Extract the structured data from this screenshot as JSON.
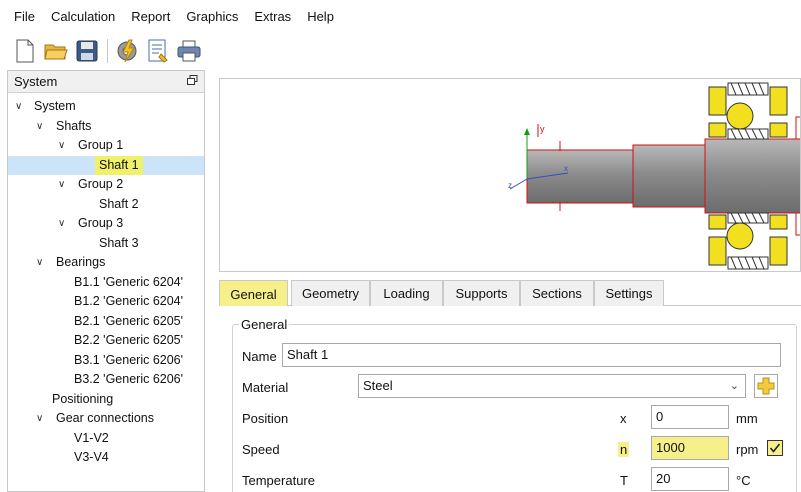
{
  "menu": [
    "File",
    "Calculation",
    "Report",
    "Graphics",
    "Extras",
    "Help"
  ],
  "toolbar": {
    "icons": [
      "new-file-icon",
      "open-folder-icon",
      "save-icon",
      "calculate-icon",
      "report-icon",
      "print-icon"
    ]
  },
  "left_panel": {
    "title": "System",
    "float_icon": "restore-window-icon",
    "tree": [
      {
        "label": "System",
        "level": 0,
        "expanded": true
      },
      {
        "label": "Shafts",
        "level": 1,
        "expanded": true
      },
      {
        "label": "Group 1",
        "level": 2,
        "expanded": true
      },
      {
        "label": "Shaft 1",
        "level": 3,
        "selected": true
      },
      {
        "label": "Group 2",
        "level": 2,
        "expanded": true
      },
      {
        "label": "Shaft 2",
        "level": 3
      },
      {
        "label": "Group 3",
        "level": 2,
        "expanded": true
      },
      {
        "label": "Shaft 3",
        "level": 3
      },
      {
        "label": "Bearings",
        "level": 1,
        "expanded": true
      },
      {
        "label": "B1.1 'Generic 6204'",
        "level": 2
      },
      {
        "label": "B1.2 'Generic 6204'",
        "level": 2
      },
      {
        "label": "B2.1 'Generic 6205'",
        "level": 2
      },
      {
        "label": "B2.2 'Generic 6205'",
        "level": 2
      },
      {
        "label": "B3.1 'Generic 6206'",
        "level": 2
      },
      {
        "label": "B3.2 'Generic 6206'",
        "level": 2
      },
      {
        "label": "Positioning",
        "level": 1
      },
      {
        "label": "Gear connections",
        "level": 1,
        "expanded": true
      },
      {
        "label": "V1-V2",
        "level": 2
      },
      {
        "label": "V3-V4",
        "level": 2
      }
    ]
  },
  "view3d": {
    "axis_labels": {
      "x": "x",
      "y": "y",
      "z": "z"
    },
    "colors": {
      "shaft": "#8f8f8f",
      "bearing": "#f2e020",
      "outline": "#d01010"
    }
  },
  "tabs": [
    {
      "label": "General",
      "active": true
    },
    {
      "label": "Geometry"
    },
    {
      "label": "Loading"
    },
    {
      "label": "Supports"
    },
    {
      "label": "Sections"
    },
    {
      "label": "Settings"
    }
  ],
  "form": {
    "group_title": "General",
    "name_label": "Name",
    "name_value": "Shaft 1",
    "material_label": "Material",
    "material_value": "Steel",
    "position_label": "Position",
    "position_symbol": "x",
    "position_value": "0",
    "position_unit": "mm",
    "speed_label": "Speed",
    "speed_symbol": "n",
    "speed_value": "1000",
    "speed_unit": "rpm",
    "speed_checked": true,
    "temperature_label": "Temperature",
    "temperature_symbol": "T",
    "temperature_value": "20",
    "temperature_unit": "°C"
  },
  "colors": {
    "highlight": "#f7f08a",
    "selection": "#cce4f7"
  }
}
